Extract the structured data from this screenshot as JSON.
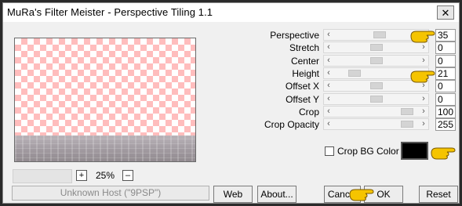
{
  "window": {
    "title": "MuRa's Filter Meister - Perspective Tiling 1.1",
    "close_glyph": "✕"
  },
  "zoom": {
    "value": "25%",
    "plus_label": "+",
    "minus_label": "–"
  },
  "status": {
    "host_text": "Unknown Host (\"9PSP\")"
  },
  "params": [
    {
      "label": "Perspective",
      "value": "35",
      "level": 0.55
    },
    {
      "label": "Stretch",
      "value": "0",
      "level": 0.5
    },
    {
      "label": "Center",
      "value": "0",
      "level": 0.5
    },
    {
      "label": "Height",
      "value": "21",
      "level": 0.2
    },
    {
      "label": "Offset X",
      "value": "0",
      "level": 0.5
    },
    {
      "label": "Offset Y",
      "value": "0",
      "level": 0.5
    },
    {
      "label": "Crop",
      "value": "100",
      "level": 0.92
    },
    {
      "label": "Crop Opacity",
      "value": "255",
      "level": 0.92
    }
  ],
  "crop_bg": {
    "label": "Crop BG Color",
    "checked": false,
    "color": "#000000"
  },
  "buttons": {
    "web": "Web",
    "about": "About...",
    "cancel": "Cancel",
    "ok": "OK",
    "reset": "Reset"
  },
  "colors": {
    "checker_pink": "#ffbdbd",
    "pointer_hand": "#f5c400"
  }
}
